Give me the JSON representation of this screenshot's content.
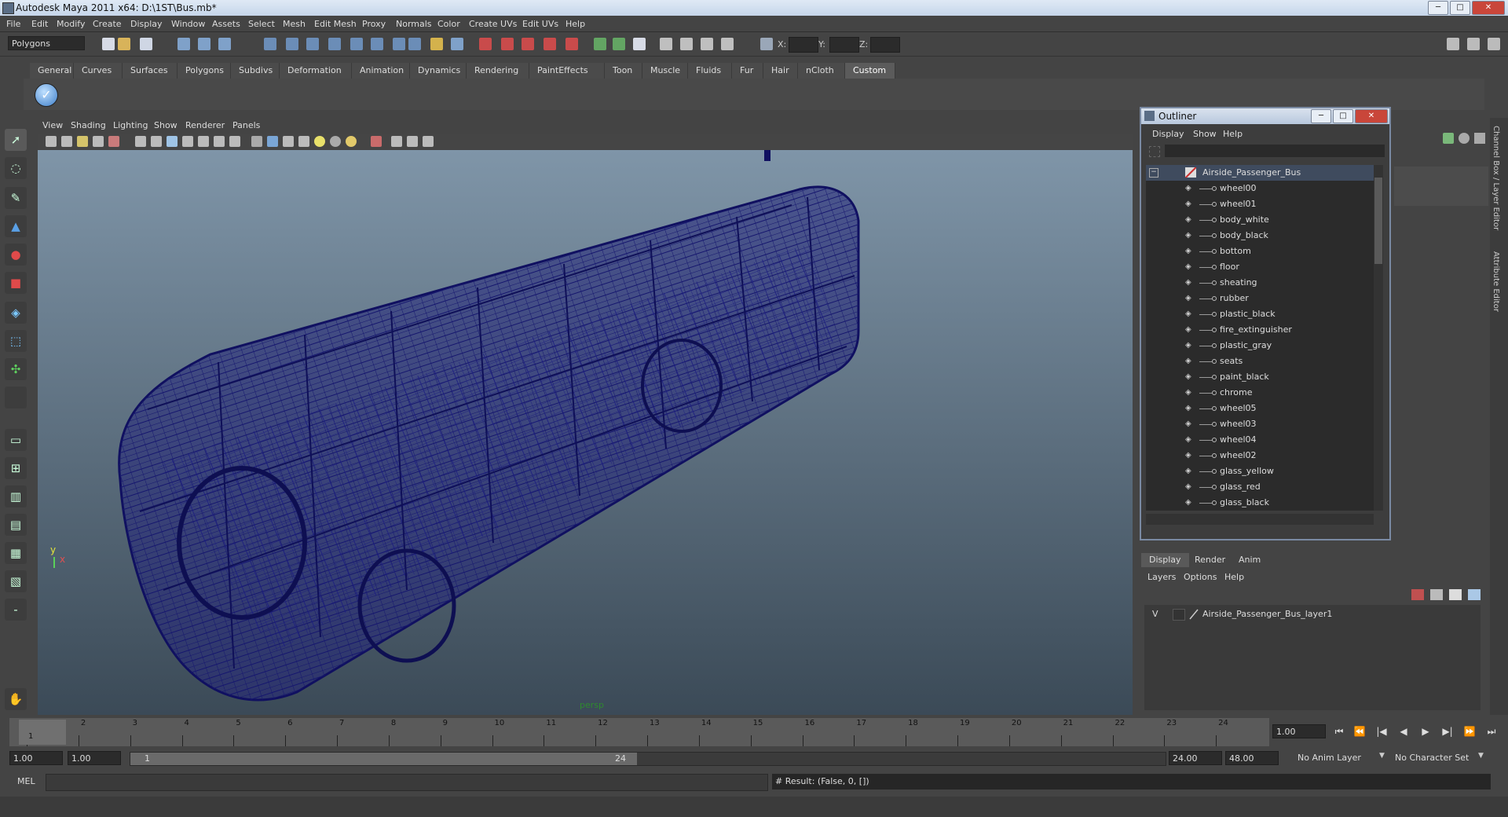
{
  "window": {
    "title": "Autodesk Maya 2011 x64: D:\\1ST\\Bus.mb*",
    "min": "─",
    "max": "□",
    "close": "✕"
  },
  "menubar": [
    "File",
    "Edit",
    "Modify",
    "Create",
    "Display",
    "Window",
    "Assets",
    "Select",
    "Mesh",
    "Edit Mesh",
    "Proxy",
    "Normals",
    "Color",
    "Create UVs",
    "Edit UVs",
    "Help"
  ],
  "statusline": {
    "mode": "Polygons",
    "x_label": "X:",
    "y_label": "Y:",
    "z_label": "Z:"
  },
  "shelf": {
    "tabs": [
      "General",
      "Curves",
      "Surfaces",
      "Polygons",
      "Subdivs",
      "Deformation",
      "Animation",
      "Dynamics",
      "Rendering",
      "PaintEffects",
      "Toon",
      "Muscle",
      "Fluids",
      "Fur",
      "Hair",
      "nCloth",
      "Custom"
    ],
    "active": "Custom"
  },
  "viewport": {
    "menu": [
      "View",
      "Shading",
      "Lighting",
      "Show",
      "Renderer",
      "Panels"
    ],
    "camera": "persp",
    "axis_x": "x",
    "axis_y": "y",
    "wire_color": "#15166e"
  },
  "outliner": {
    "title": "Outliner",
    "menu": [
      "Display",
      "Show",
      "Help"
    ],
    "root": "Airside_Passenger_Bus",
    "items": [
      "wheel00",
      "wheel01",
      "body_white",
      "body_black",
      "bottom",
      "floor",
      "sheating",
      "rubber",
      "plastic_black",
      "fire_extinguisher",
      "plastic_gray",
      "seats",
      "paint_black",
      "chrome",
      "wheel05",
      "wheel03",
      "wheel04",
      "wheel02",
      "glass_yellow",
      "glass_red",
      "glass_black"
    ]
  },
  "sidetabs": {
    "channel": "Channel Box / Layer Editor",
    "attribute": "Attribute Editor"
  },
  "layers": {
    "tabs": [
      "Display",
      "Render",
      "Anim"
    ],
    "active": "Display",
    "menu": [
      "Layers",
      "Options",
      "Help"
    ],
    "rows": [
      {
        "visible": "V",
        "name": "Airside_Passenger_Bus_layer1"
      }
    ]
  },
  "timeslider": {
    "ticks": [
      "1",
      "2",
      "3",
      "4",
      "5",
      "6",
      "7",
      "8",
      "9",
      "10",
      "11",
      "12",
      "13",
      "14",
      "15",
      "16",
      "17",
      "18",
      "19",
      "20",
      "21",
      "22",
      "23",
      "24"
    ],
    "current": "1",
    "current_field": "1.00"
  },
  "range": {
    "start": "1.00",
    "anim_start": "1.00",
    "slider_start": "1",
    "slider_end": "24",
    "anim_end": "24.00",
    "end": "48.00",
    "anim_layer": "No Anim Layer",
    "char_set": "No Character Set"
  },
  "commandline": {
    "label": "MEL",
    "result": "# Result: (False, 0, [])"
  }
}
